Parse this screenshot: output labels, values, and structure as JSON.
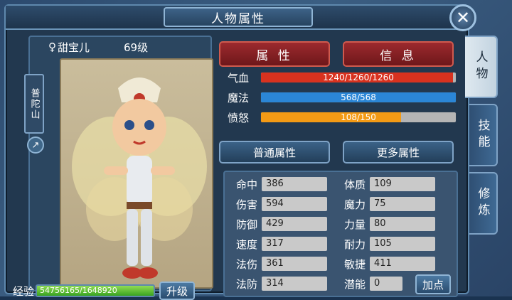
{
  "window": {
    "title": "人物属性"
  },
  "character": {
    "gender_symbol": "♀",
    "name": "甜宝儿",
    "level": "69级",
    "school": "普陀山"
  },
  "tabs": {
    "attributes": "属 性",
    "info": "信 息"
  },
  "bars": [
    {
      "label": "气血",
      "text": "1240/1260/1260",
      "fraction": 0.984,
      "color": "#d8321f"
    },
    {
      "label": "魔法",
      "text": "568/568",
      "fraction": 1.0,
      "color": "#2b86d6"
    },
    {
      "label": "愤怒",
      "text": "108/150",
      "fraction": 0.72,
      "color": "#f39a15"
    }
  ],
  "sub_tabs": {
    "normal": "普通属性",
    "more": "更多属性"
  },
  "stats_left": [
    {
      "label": "命中",
      "value": "386"
    },
    {
      "label": "伤害",
      "value": "594"
    },
    {
      "label": "防御",
      "value": "429"
    },
    {
      "label": "速度",
      "value": "317"
    },
    {
      "label": "法伤",
      "value": "361"
    },
    {
      "label": "法防",
      "value": "314"
    }
  ],
  "stats_right": [
    {
      "label": "体质",
      "value": "109"
    },
    {
      "label": "魔力",
      "value": "75"
    },
    {
      "label": "力量",
      "value": "80"
    },
    {
      "label": "耐力",
      "value": "105"
    },
    {
      "label": "敏捷",
      "value": "411"
    },
    {
      "label": "潜能",
      "value": "0"
    }
  ],
  "add_point": "加点",
  "exp": {
    "label": "经验",
    "text": "54756165/1648920",
    "fraction": 1.0
  },
  "upgrade": "升级",
  "side_tabs": [
    "人物",
    "技能",
    "修炼"
  ]
}
